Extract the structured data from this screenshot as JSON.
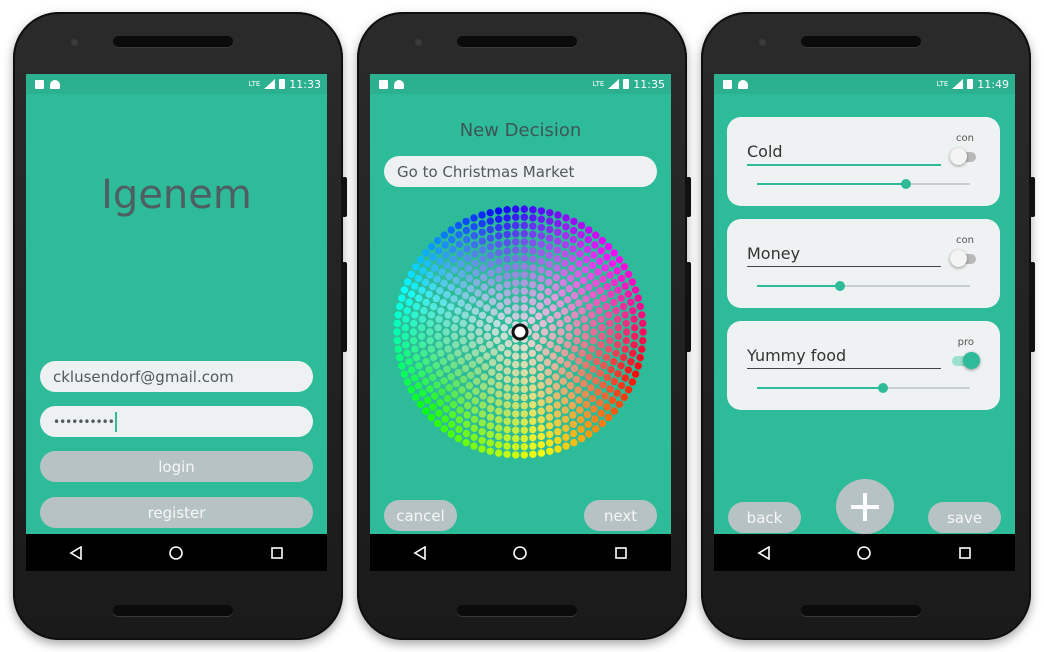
{
  "colors": {
    "teal": "#2ebb9a",
    "grey_button": "#b7c2c4",
    "field_bg": "#eef1f1"
  },
  "screens": [
    {
      "status": {
        "time": "11:33",
        "network": "LTE"
      },
      "app_title": "Igenem",
      "email_value": "cklusendorf@gmail.com",
      "password_value": "••••••••••",
      "login_label": "login",
      "register_label": "register"
    },
    {
      "status": {
        "time": "11:35",
        "network": "LTE"
      },
      "header": "New Decision",
      "decision_value": "Go to Christmas Market",
      "cancel_label": "cancel",
      "next_label": "next"
    },
    {
      "status": {
        "time": "11:49",
        "network": "LTE"
      },
      "items": [
        {
          "label": "Cold",
          "type": "con",
          "toggle_on": false,
          "weight": 0.7
        },
        {
          "label": "Money",
          "type": "con",
          "toggle_on": false,
          "weight": 0.39
        },
        {
          "label": "Yummy food",
          "type": "pro",
          "toggle_on": true,
          "weight": 0.59
        }
      ],
      "back_label": "back",
      "add_icon": "plus-icon",
      "save_label": "save"
    }
  ],
  "nav_icons": [
    "back-icon",
    "home-icon",
    "recents-icon"
  ]
}
